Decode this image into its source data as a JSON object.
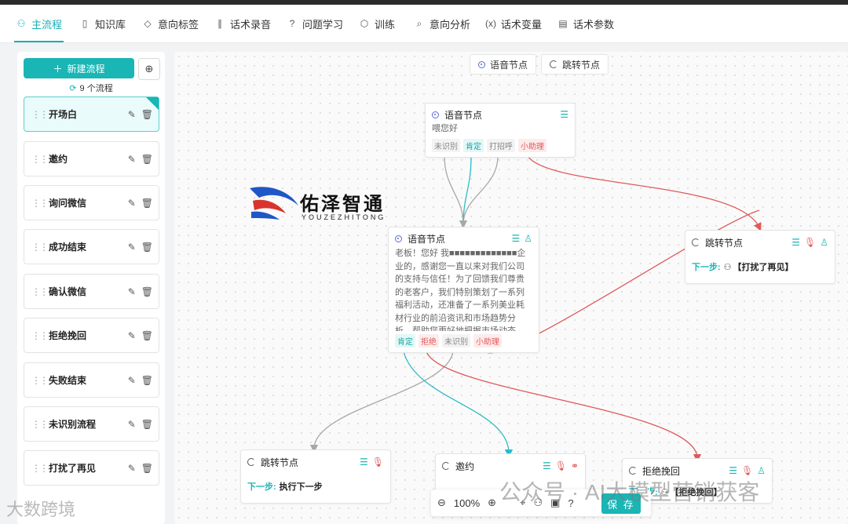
{
  "tabs": [
    {
      "label": "主流程",
      "icon": "flow-icon",
      "active": true
    },
    {
      "label": "知识库",
      "icon": "book-icon"
    },
    {
      "label": "意向标签",
      "icon": "tag-icon"
    },
    {
      "label": "话术录音",
      "icon": "waveform-icon"
    },
    {
      "label": "问题学习",
      "icon": "question-icon"
    },
    {
      "label": "训练",
      "icon": "cube-icon"
    },
    {
      "label": "意向分析",
      "icon": "analysis-icon"
    },
    {
      "label": "话术变量",
      "icon": "variable-icon"
    },
    {
      "label": "话术参数",
      "icon": "parameter-icon"
    }
  ],
  "sidebar": {
    "new_button": "新建流程",
    "new_button_icon": "plus-icon",
    "search_icon": "zoom-search-icon",
    "count_label": "9 个流程",
    "flows": [
      {
        "name": "开场白",
        "active": true
      },
      {
        "name": "邀约"
      },
      {
        "name": "询问微信"
      },
      {
        "name": "成功结束"
      },
      {
        "name": "确认微信"
      },
      {
        "name": "拒绝挽回"
      },
      {
        "name": "失败结束"
      },
      {
        "name": "未识别流程"
      },
      {
        "name": "打扰了再见"
      }
    ]
  },
  "palette": {
    "voice_node": "语音节点",
    "jump_node": "跳转节点"
  },
  "nodes": {
    "greet": {
      "title": "语音节点",
      "text": "喂您好",
      "tags": [
        "未识别",
        "肯定",
        "打招呼",
        "小助理"
      ]
    },
    "main": {
      "title": "语音节点",
      "text": "老板！您好 我■■■■■■■■■■■■■企业的，感谢您一直以来对我们公司的支持与信任！为了回馈我们尊贵的老客户，我们特别策划了一系列福利活动，还准备了一系列美业耗材行业的前沿资讯和市场趋势分析，帮助您更好地把握市场动态，提升竞争力这边加您微信把资料发给您，您看可以吗?",
      "tags": [
        "肯定",
        "拒绝",
        "未识别",
        "小助理"
      ]
    },
    "jump_right": {
      "title": "跳转节点",
      "next_label": "下一步:",
      "next_value": "【打扰了再见】"
    },
    "jump_bottom": {
      "title": "跳转节点",
      "next_label": "下一步:",
      "next_value": "执行下一步"
    },
    "invite": {
      "title": "邀约"
    },
    "retain": {
      "title": "拒绝挽回",
      "next_label": "下一步:",
      "next_value": "【拒绝挽回】"
    }
  },
  "logo": {
    "cn": "佑泽智通",
    "en": "YOUZEZHITONG"
  },
  "zoombar": {
    "zoom": "100%",
    "save": "保 存"
  },
  "watermarks": {
    "wechat": "公众号 · AI大模型营销获客",
    "corner": "大数跨境"
  },
  "colors": {
    "accent": "#1ab5b5",
    "red": "#e05a5a",
    "gray_line": "#a8a8a8"
  }
}
